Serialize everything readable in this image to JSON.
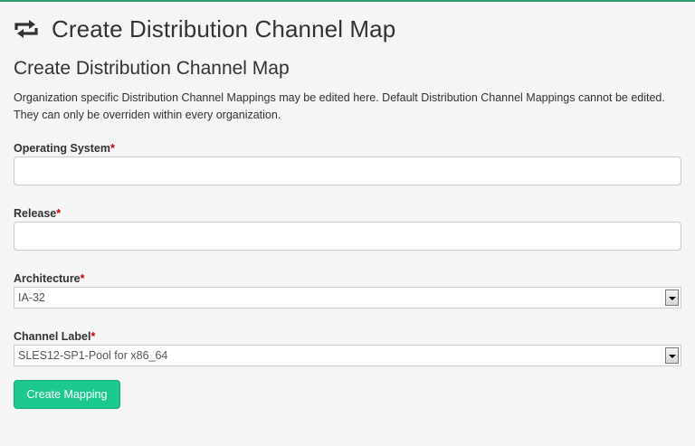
{
  "header": {
    "icon": "sync-arrows-icon",
    "title": "Create Distribution Channel Map"
  },
  "form": {
    "subtitle": "Create Distribution Channel Map",
    "description": "Organization specific Distribution Channel Mappings may be edited here. Default Distribution Channel Mappings cannot be edited. They can only be overriden within every organization.",
    "required_marker": "*",
    "operating_system": {
      "label": "Operating System",
      "value": "",
      "placeholder": ""
    },
    "release": {
      "label": "Release",
      "value": "",
      "placeholder": ""
    },
    "architecture": {
      "label": "Architecture",
      "selected": "IA-32"
    },
    "channel_label": {
      "label": "Channel Label",
      "selected": "SLES12-SP1-Pool for x86_64"
    },
    "submit_label": "Create Mapping"
  },
  "colors": {
    "accent": "#1cc88f",
    "top_rule": "#2e9b6e",
    "required": "#cc0000",
    "background": "#f5f5f5"
  }
}
